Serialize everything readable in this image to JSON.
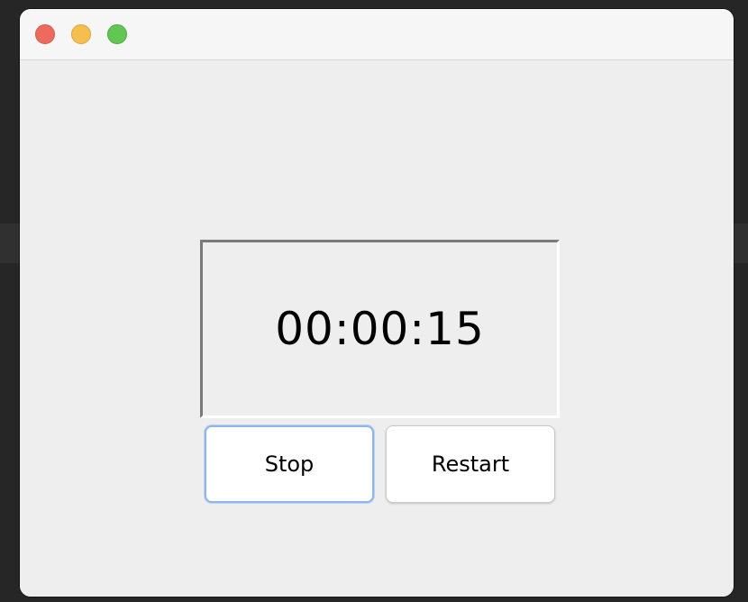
{
  "timer": {
    "display": "00:00:15"
  },
  "buttons": {
    "stop_label": "Stop",
    "restart_label": "Restart"
  },
  "colors": {
    "close": "#ed6a5e",
    "minimize": "#f5bf4f",
    "zoom": "#62c554",
    "focus_ring": "#8fb6e6"
  }
}
